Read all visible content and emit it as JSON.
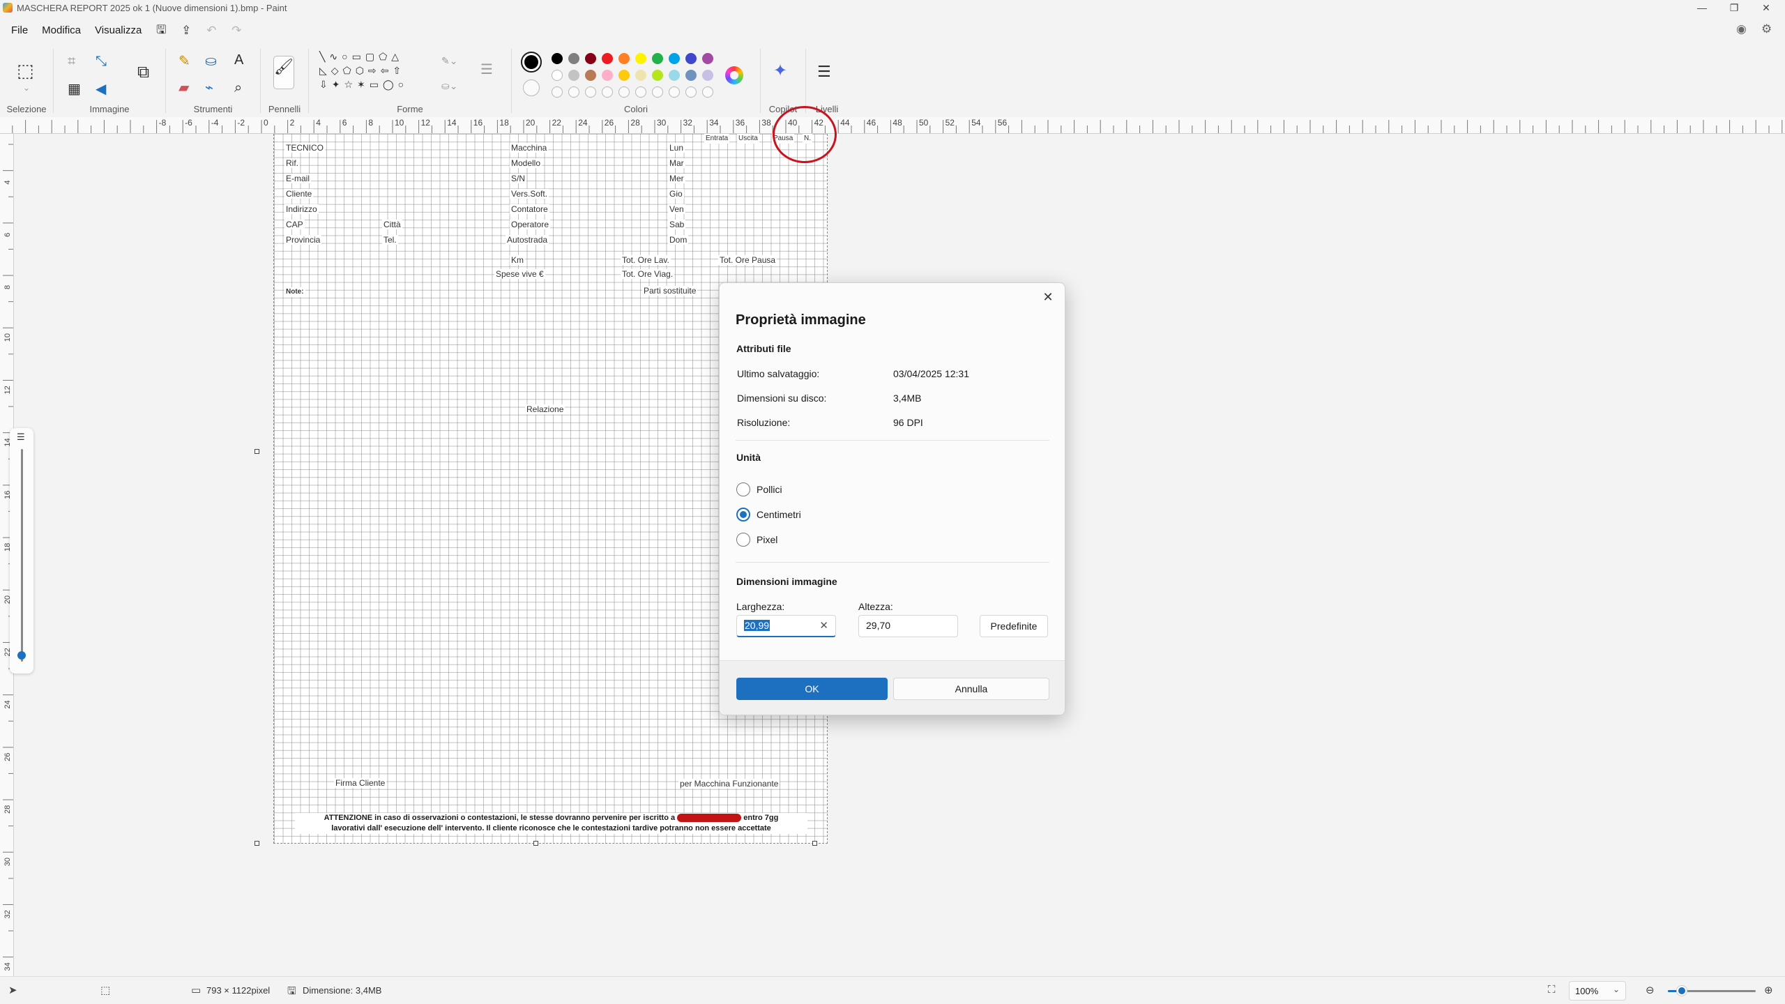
{
  "window": {
    "title": "MASCHERA REPORT 2025 ok 1 (Nuove dimensioni 1).bmp - Paint",
    "controls": [
      "—",
      "❐",
      "✕"
    ]
  },
  "menu": {
    "items": [
      "File",
      "Modifica",
      "Visualizza"
    ]
  },
  "ribbon": {
    "groups": [
      "Selezione",
      "Immagine",
      "Strumenti",
      "Pennelli",
      "Forme",
      "Colori",
      "Copilot",
      "Livelli"
    ],
    "colors": {
      "selected": "#000000",
      "row1": [
        "#000000",
        "#7f7f7f",
        "#880015",
        "#ed1c24",
        "#ff7f27",
        "#fff200",
        "#22b14c",
        "#00a2e8",
        "#3f48cc",
        "#a349a4"
      ],
      "row2": [
        "#ffffff",
        "#c3c3c3",
        "#b97a57",
        "#ffaec9",
        "#ffc90e",
        "#efe4b0",
        "#b5e61d",
        "#99d9ea",
        "#7092be",
        "#c8bfe7"
      ]
    }
  },
  "ruler": {
    "h_labels": [
      "-8",
      "-6",
      "-4",
      "-2",
      "0",
      "2",
      "4",
      "6",
      "8",
      "10",
      "12",
      "14",
      "16",
      "18",
      "20",
      "22",
      "24",
      "26",
      "28",
      "30",
      "32",
      "34",
      "36",
      "38",
      "40",
      "42",
      "44",
      "46",
      "48",
      "50",
      "52",
      "54",
      "56"
    ],
    "v_labels": [
      "4",
      "6",
      "8",
      "10",
      "12",
      "14",
      "16",
      "18",
      "20",
      "22",
      "24",
      "26",
      "28",
      "30",
      "32",
      "34"
    ]
  },
  "document": {
    "header_right": [
      "Entrata",
      "Uscita",
      "Pausa",
      "N."
    ],
    "col1": [
      "TECNICO",
      "Rif.",
      "E-mail",
      "Cliente",
      "Indirizzo",
      "CAP",
      "Provincia"
    ],
    "col1b": [
      "Città",
      "Tel."
    ],
    "col2": [
      "Macchina",
      "Modello",
      "S/N",
      "Vers.Soft.",
      "Contatore",
      "Operatore",
      "Autostrada"
    ],
    "days": [
      "Lun",
      "Mar",
      "Mer",
      "Gio",
      "Ven",
      "Sab",
      "Dom"
    ],
    "km": "Km",
    "spese": "Spese vive €",
    "tot_lav": "Tot. Ore Lav.",
    "tot_viag": "Tot. Ore Viag.",
    "tot_pausa": "Tot. Ore Pausa",
    "note": "Note:",
    "parti": "Parti sostituite",
    "relazione": "Relazione",
    "firma": "Firma Cliente",
    "macchina_ok": "per Macchina Funzionante",
    "warning_1a": "ATTENZIONE in caso di osservazioni o contestazioni, le stesse dovranno pervenire per iscritto a",
    "warning_1b": "entro 7gg",
    "warning_2": "lavorativi dall' esecuzione dell' intervento. Il cliente riconosce che le contestazioni tardive potranno non essere accettate"
  },
  "dialog": {
    "title": "Proprietà immagine",
    "file_attrs_heading": "Attributi file",
    "last_saved_label": "Ultimo salvataggio:",
    "last_saved_value": "03/04/2025 12:31",
    "disk_size_label": "Dimensioni su disco:",
    "disk_size_value": "3,4MB",
    "resolution_label": "Risoluzione:",
    "resolution_value": "96 DPI",
    "units_heading": "Unità",
    "unit_options": [
      "Pollici",
      "Centimetri",
      "Pixel"
    ],
    "unit_selected": "Centimetri",
    "dims_heading": "Dimensioni immagine",
    "width_label": "Larghezza:",
    "width_value": "20,99",
    "height_label": "Altezza:",
    "height_value": "29,70",
    "defaults_button": "Predefinite",
    "ok_button": "OK",
    "cancel_button": "Annulla"
  },
  "status": {
    "pixel_size": "793 × 1122pixel",
    "file_size": "Dimensione: 3,4MB",
    "zoom": "100%",
    "zoom_fraction": 0.1
  }
}
